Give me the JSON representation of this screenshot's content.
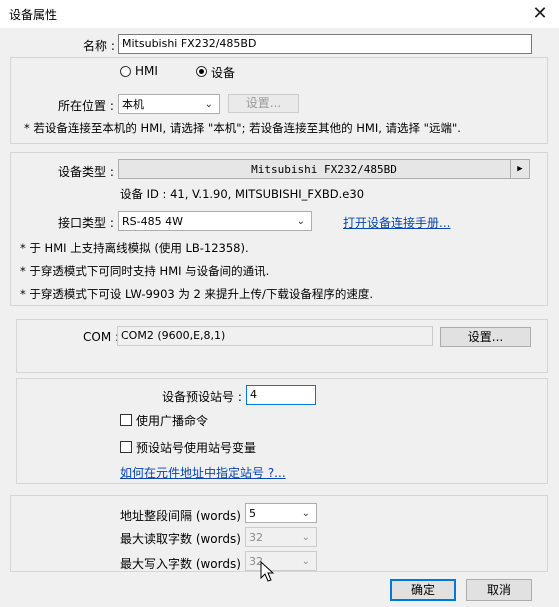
{
  "window": {
    "title": "设备属性",
    "close_glyph": "✕"
  },
  "name": {
    "label": "名称 :",
    "value": "Mitsubishi FX232/485BD"
  },
  "mode": {
    "hmi_label": "HMI",
    "device_label": "设备",
    "selected": "device"
  },
  "location": {
    "label": "所在位置 :",
    "value": "本机",
    "settings_label": "设置...",
    "note": "* 若设备连接至本机的 HMI, 请选择 \"本机\"; 若设备连接至其他的 HMI, 请选择 \"远端\"."
  },
  "device_type": {
    "label": "设备类型 :",
    "value": "Mitsubishi FX232/485BD",
    "info": "设备 ID : 41, V.1.90, MITSUBISHI_FXBD.e30"
  },
  "interface": {
    "label": "接口类型 :",
    "value": "RS-485 4W",
    "manual_link": "打开设备连接手册..."
  },
  "notes": [
    "* 于 HMI 上支持离线模拟 (使用 LB-12358).",
    "* 于穿透模式下可同时支持 HMI 与设备间的通讯.",
    "* 于穿透模式下可设 LW-9903 为 2 来提升上传/下载设备程序的速度."
  ],
  "com": {
    "label": "COM :",
    "value": "COM2 (9600,E,8,1)",
    "settings_label": "设置..."
  },
  "station": {
    "label": "设备预设站号 :",
    "value": "4",
    "broadcast_label": "使用广播命令",
    "broadcast_checked": false,
    "var_label": "预设站号使用站号变量",
    "var_checked": false,
    "help_link": "如何在元件地址中指定站号 ?..."
  },
  "words": {
    "interval_label": "地址整段间隔 (words) :",
    "interval_value": "5",
    "read_label": "最大读取字数 (words) :",
    "read_value": "32",
    "write_label": "最大写入字数 (words) :",
    "write_value": "32"
  },
  "footer": {
    "ok_label": "确定",
    "cancel_label": "取消"
  },
  "icons": {
    "dropdown": "chevron-down-icon",
    "arrow": "arrow-right-icon",
    "cursor": "mouse-pointer-icon"
  }
}
